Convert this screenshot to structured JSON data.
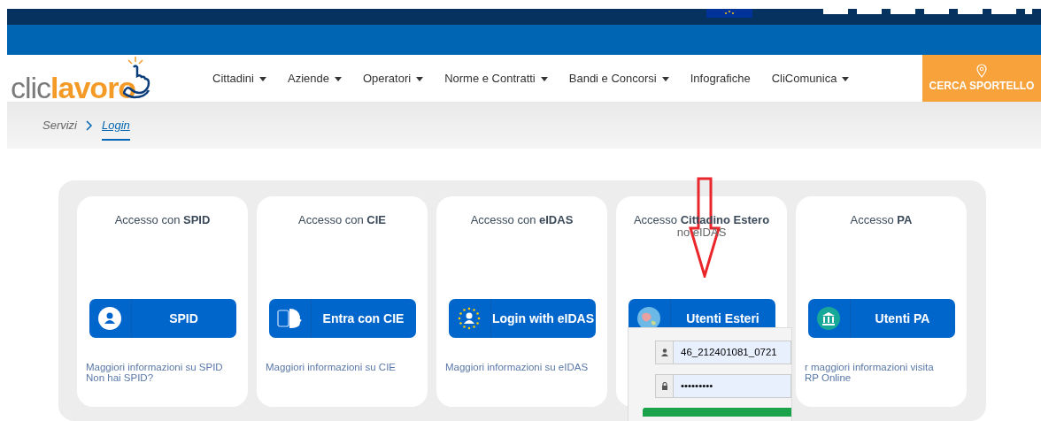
{
  "header": {
    "logo": {
      "part_1": "clic",
      "part_2": "lavoro"
    }
  },
  "nav": {
    "items": [
      {
        "label": "Cittadini",
        "dropdown": true
      },
      {
        "label": "Aziende",
        "dropdown": true
      },
      {
        "label": "Operatori",
        "dropdown": true
      },
      {
        "label": "Norme e Contratti",
        "dropdown": true
      },
      {
        "label": "Bandi e Concorsi",
        "dropdown": true
      },
      {
        "label": "Infografiche",
        "dropdown": false
      },
      {
        "label": "CliComunica",
        "dropdown": true
      }
    ],
    "cta": "CERCA SPORTELLO"
  },
  "breadcrumb": [
    {
      "label": "Servizi",
      "selected": false
    },
    {
      "label": "Login",
      "selected": true
    }
  ],
  "cards": [
    {
      "title": "Accesso con **SPID**",
      "button": "SPID",
      "links": [
        "Maggiori informazioni su SPID",
        "Non hai SPID?"
      ]
    },
    {
      "title": "Accesso con **CIE**",
      "button": "Entra con CIE",
      "links": [
        "Maggiori informazioni su CIE"
      ]
    },
    {
      "title": "Accesso con **eIDAS**",
      "button": "Login with eIDAS",
      "links": [
        "Maggiori informazioni su eIDAS"
      ]
    },
    {
      "title": "Accesso **Cittadino Estero**",
      "subtitle": "no eIDAS",
      "button": "Utenti Esteri",
      "popup": {
        "username": "46_212401081_0721",
        "password": "•••••••••"
      }
    },
    {
      "title": "Accesso **PA**",
      "button": "Utenti PA",
      "links": [
        "r maggiori informazioni visita",
        "RP Online"
      ]
    }
  ]
}
